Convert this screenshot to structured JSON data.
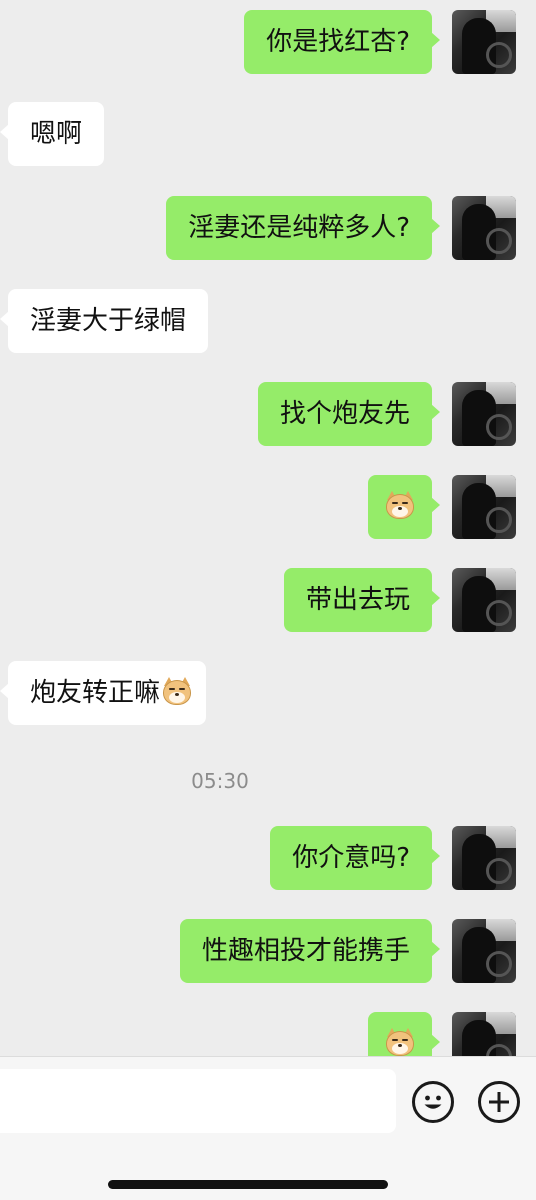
{
  "chat": {
    "messages": [
      {
        "side": "me",
        "text": "你是找红杏?"
      },
      {
        "side": "other",
        "text": "嗯啊"
      },
      {
        "side": "me",
        "text": "淫妻还是纯粹多人?"
      },
      {
        "side": "other",
        "text": "淫妻大于绿帽"
      },
      {
        "side": "me",
        "text": "找个炮友先"
      },
      {
        "side": "me",
        "sticker": "doge-emoji"
      },
      {
        "side": "me",
        "text": "带出去玩"
      },
      {
        "side": "other",
        "text": "炮友转正嘛",
        "trailing_emoji": "doge-emoji"
      },
      {
        "side": "me",
        "text": "你介意吗?"
      },
      {
        "side": "me",
        "text": "性趣相投才能携手"
      },
      {
        "side": "me",
        "sticker": "doge-emoji"
      }
    ],
    "timestamp": "05:30"
  },
  "input": {
    "value": "",
    "placeholder": "",
    "emoji_icon": "smiley-face-icon",
    "plus_icon": "plus-circle-icon"
  },
  "colors": {
    "background": "#ededed",
    "my_bubble": "#95ec69",
    "other_bubble": "#ffffff",
    "timestamp_text": "#8c8c8c"
  }
}
